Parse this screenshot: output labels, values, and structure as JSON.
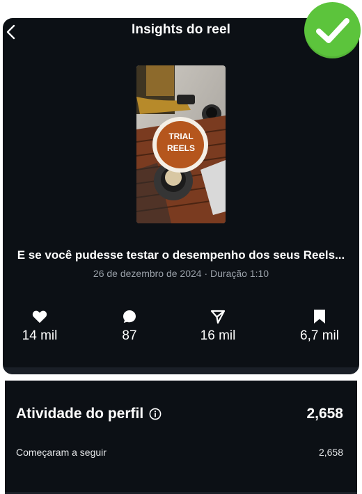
{
  "header": {
    "title": "Insights do reel",
    "back_icon": "chevron-left-icon"
  },
  "badge": {
    "icon": "checkmark-icon",
    "color": "#5cc43c"
  },
  "reel": {
    "thumbnail_text_line1": "TRIAL",
    "thumbnail_text_line2": "REELS",
    "title": "E se você pudesse testar o desempenho dos seus Reels...",
    "meta": "26 de dezembro de 2024 · Duração 1:10"
  },
  "stats": [
    {
      "icon": "heart-icon",
      "value": "14 mil"
    },
    {
      "icon": "comment-icon",
      "value": "87"
    },
    {
      "icon": "share-icon",
      "value": "16 mil"
    },
    {
      "icon": "bookmark-icon",
      "value": "6,7 mil"
    }
  ],
  "profile_activity": {
    "title": "Atividade do perfil",
    "total": "2,658",
    "rows": [
      {
        "label": "Começaram a seguir",
        "value": "2,658"
      }
    ]
  }
}
